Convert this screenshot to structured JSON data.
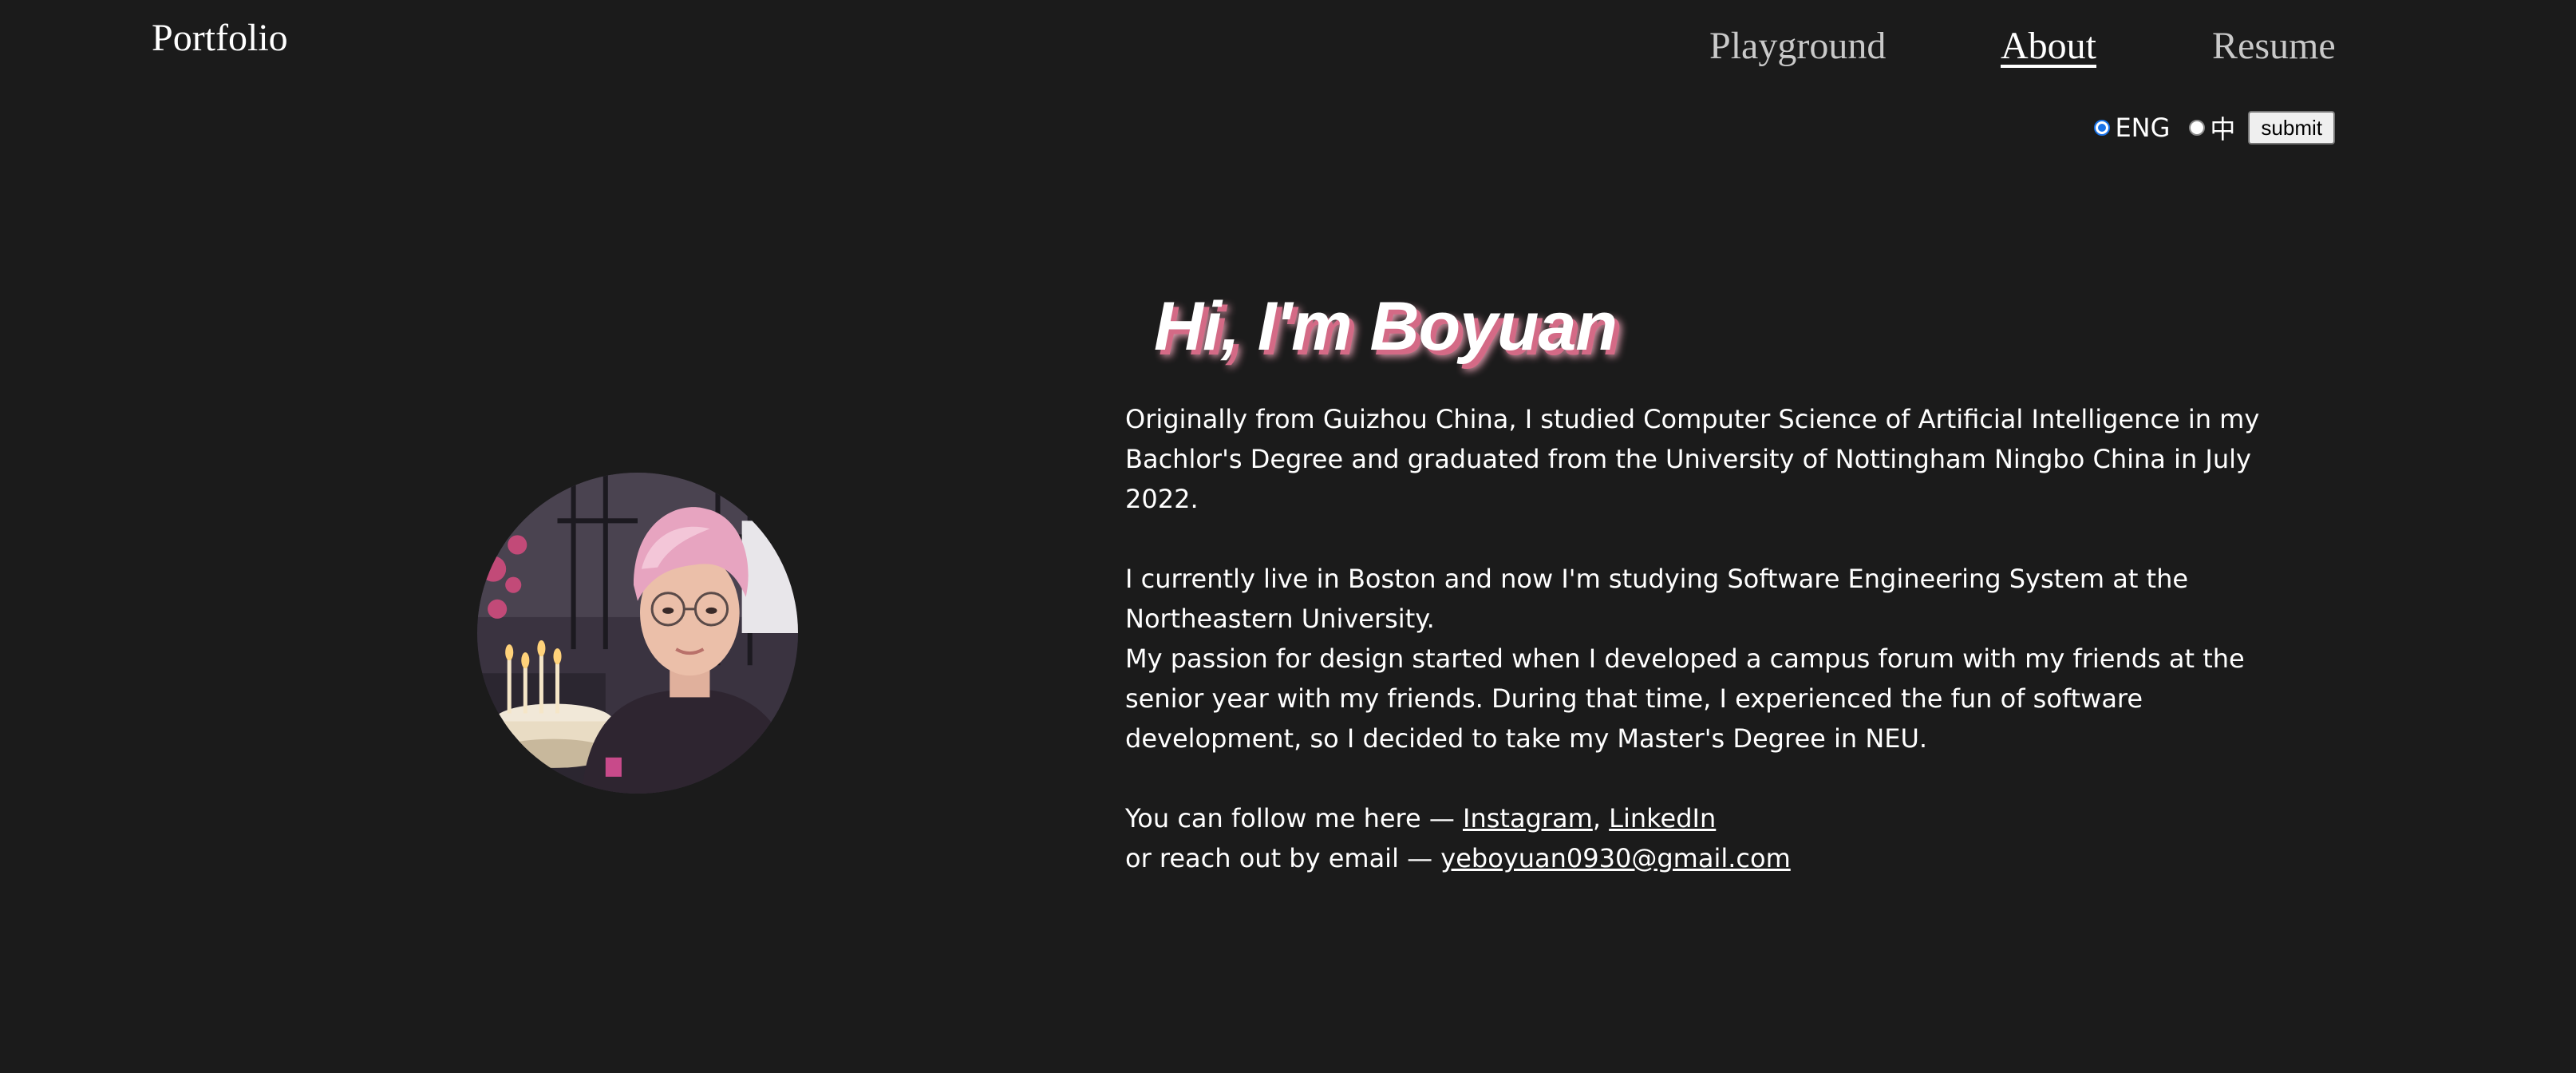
{
  "header": {
    "brand": "Portfolio",
    "nav": [
      {
        "label": "Playground"
      },
      {
        "label": "About"
      },
      {
        "label": "Resume"
      }
    ]
  },
  "language": {
    "options": [
      "ENG",
      "中"
    ],
    "selected": "ENG",
    "submit_label": "submit"
  },
  "hero": {
    "headline": "Hi, I'm Boyuan",
    "paragraph_1": "Originally from Guizhou China, I studied Computer Science of Artificial Intelligence in my Bachlor's Degree and graduated from the University of Nottingham Ningbo China in July 2022.",
    "paragraph_2": "I currently live in Boston and now I'm studying Software Engineering System at the Northeastern University.",
    "paragraph_3": "My passion for design started when I developed a campus forum with my friends at the senior year with my friends. During that time, I experienced the fun of software development, so I decided to take my Master's Degree in NEU.",
    "follow_prefix": "You can follow me here — ",
    "follow_links": [
      "Instagram",
      "LinkedIn"
    ],
    "follow_separator": ", ",
    "email_prefix": "or reach out by email — ",
    "email": "yeboyuan0930@gmail.com"
  },
  "colors": {
    "background": "#1b1b1b",
    "text": "#ffffff",
    "nav_inactive": "#c9c9c9",
    "headline_shadow": "#d46a86"
  }
}
